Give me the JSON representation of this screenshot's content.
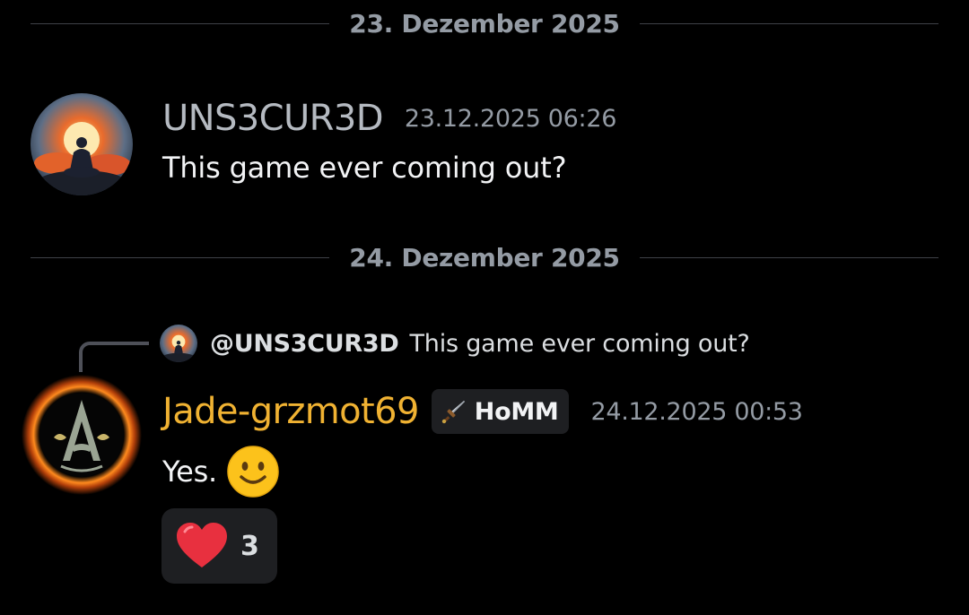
{
  "dividers": [
    {
      "date": "23. Dezember 2025"
    },
    {
      "date": "24. Dezember 2025"
    }
  ],
  "messages": [
    {
      "username": "UNS3CUR3D",
      "timestamp": "23.12.2025 06:26",
      "text": "This game ever coming out?",
      "avatar_icon": "meditation-sunset-avatar"
    },
    {
      "reply": {
        "username": "@UNS3CUR3D",
        "text": "This game ever coming out?"
      },
      "username": "Jade-grzmot69",
      "username_color": "#f0b232",
      "role_tag": {
        "label": "HoMM",
        "icon": "sword-icon"
      },
      "timestamp": "24.12.2025 00:53",
      "text": "Yes.",
      "emoji": "slightly-smiling-face",
      "avatar_icon": "assassin-insignia-avatar",
      "reactions": [
        {
          "emoji": "heart",
          "count": "3"
        }
      ]
    }
  ],
  "colors": {
    "background": "#000000",
    "divider_text": "#949ba4",
    "username_default": "#b5bac1",
    "username_highlight": "#f0b232",
    "chip_background": "#1e1f22",
    "heart": "#e8303f"
  }
}
